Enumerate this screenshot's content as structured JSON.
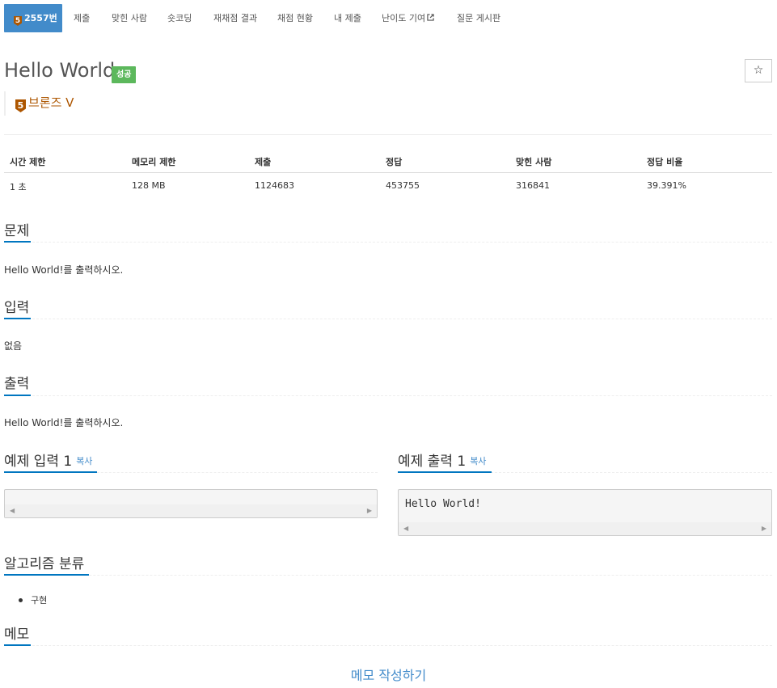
{
  "nav": {
    "tabs": [
      {
        "label": "2557번",
        "tier": "5"
      },
      {
        "label": "제출"
      },
      {
        "label": "맞힌 사람"
      },
      {
        "label": "숏코딩"
      },
      {
        "label": "재채점 결과"
      },
      {
        "label": "채점 현황"
      },
      {
        "label": "내 제출"
      },
      {
        "label": "난이도 기여"
      },
      {
        "label": "질문 게시판"
      }
    ]
  },
  "problem": {
    "title": "Hello World",
    "status": "성공",
    "tier_number": "5",
    "tier_label": "브론즈 V"
  },
  "info_table": {
    "headers": [
      "시간 제한",
      "메모리 제한",
      "제출",
      "정답",
      "맞힌 사람",
      "정답 비율"
    ],
    "row": [
      "1 초",
      "128 MB",
      "1124683",
      "453755",
      "316841",
      "39.391%"
    ]
  },
  "sections": {
    "problem_header": "문제",
    "problem_text": "Hello World!를 출력하시오.",
    "input_header": "입력",
    "input_text": "없음",
    "output_header": "출력",
    "output_text": "Hello World!를 출력하시오."
  },
  "samples": {
    "input_header": "예제 입력 1",
    "output_header": "예제 출력 1",
    "copy_label": "복사",
    "input_value": "",
    "output_value": "Hello World!"
  },
  "algorithm": {
    "header": "알고리즘 분류",
    "tags": [
      "구현"
    ]
  },
  "memo": {
    "header": "메모",
    "link": "메모 작성하기"
  },
  "colors": {
    "primary": "#428bca",
    "bronze": "#ad5600",
    "success": "#5cb85c",
    "section_underline": "#0076c0"
  }
}
